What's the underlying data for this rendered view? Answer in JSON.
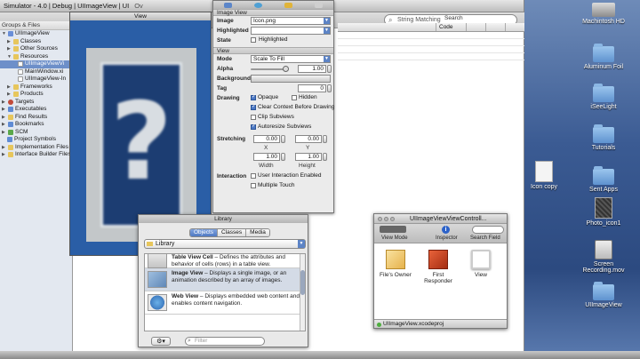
{
  "xcode": {
    "title": "Simulator - 4.0 | Debug | UIImageView | UI",
    "overview": "Ov",
    "search": {
      "placeholder": "String Matching",
      "label": "Search"
    },
    "columns": [
      "",
      "Code",
      "",
      "",
      ""
    ]
  },
  "sidebar": {
    "header": "Groups & Files",
    "items": [
      {
        "label": "UIImageView",
        "icon": "project-icon"
      },
      {
        "label": "Classes",
        "icon": "folder-icon"
      },
      {
        "label": "Other Sources",
        "icon": "folder-icon"
      },
      {
        "label": "Resources",
        "icon": "folder-icon"
      },
      {
        "label": "UIImageViewVi",
        "icon": "file-icon"
      },
      {
        "label": "MainWindow.xi",
        "icon": "file-icon"
      },
      {
        "label": "UIImageView-In",
        "icon": "file-icon"
      },
      {
        "label": "Frameworks",
        "icon": "folder-icon"
      },
      {
        "label": "Products",
        "icon": "folder-icon"
      },
      {
        "label": "Targets",
        "icon": "target-icon"
      },
      {
        "label": "Executables",
        "icon": "executable-icon"
      },
      {
        "label": "Find Results",
        "icon": "find-icon"
      },
      {
        "label": "Bookmarks",
        "icon": "bookmark-icon"
      },
      {
        "label": "SCM",
        "icon": "scm-icon"
      },
      {
        "label": "Project Symbols",
        "icon": "symbols-icon"
      },
      {
        "label": "Implementation Files",
        "icon": "folder-icon"
      },
      {
        "label": "Interface Builder Files",
        "icon": "folder-icon"
      }
    ]
  },
  "preview": {
    "title": "View"
  },
  "inspector": {
    "section_image_view": "Image View",
    "image_label": "Image",
    "image_value": "Icon.png",
    "highlighted_label": "Highlighted",
    "state_label": "State",
    "state_checkbox": "Highlighted",
    "section_view": "View",
    "mode_label": "Mode",
    "mode_value": "Scale To Fill",
    "alpha_label": "Alpha",
    "alpha_value": "1.00",
    "alpha_fraction": 1.0,
    "background_label": "Background",
    "tag_label": "Tag",
    "tag_value": "0",
    "drawing_label": "Drawing",
    "opaque": "Opaque",
    "hidden": "Hidden",
    "clear_context": "Clear Context Before Drawing",
    "clip_subviews": "Clip Subviews",
    "autoresize": "Autoresize Subviews",
    "stretching_label": "Stretching",
    "stretch_x": "0.00",
    "stretch_y": "0.00",
    "stretch_w": "1.00",
    "stretch_h": "1.00",
    "x_label": "X",
    "y_label": "Y",
    "width_label": "Width",
    "height_label": "Height",
    "interaction_label": "Interaction",
    "user_interaction": "User Interaction Enabled",
    "multiple_touch": "Multiple Touch"
  },
  "library": {
    "title": "Library",
    "tabs": [
      "Objects",
      "Classes",
      "Media"
    ],
    "popup": "Library",
    "items": [
      {
        "name": "Table View Cell",
        "desc": " – Defines the attributes and behavior of cells (rows) in a table view."
      },
      {
        "name": "Image View",
        "desc": " – Displays a single image, or an animation described by an array of images."
      },
      {
        "name": "Web View",
        "desc": " – Displays embedded web content and enables content navigation."
      }
    ],
    "filter_placeholder": "Filter"
  },
  "docwin": {
    "title": "UIImageViewViewControll...",
    "view_mode": "View Mode",
    "inspector": "Inspector",
    "search_field": "Search Field",
    "objects": [
      "File's Owner",
      "First Responder",
      "View"
    ],
    "status": "UIImageView.xcodeproj"
  },
  "desktop": {
    "icons": [
      "Machintosh HD",
      "Aluminum Foil",
      "iSeeLight",
      "Tutorials",
      "Icon copy",
      "Sent Apps",
      "Photo_icon1",
      "Screen Recording.mov",
      "UIImageView"
    ]
  }
}
